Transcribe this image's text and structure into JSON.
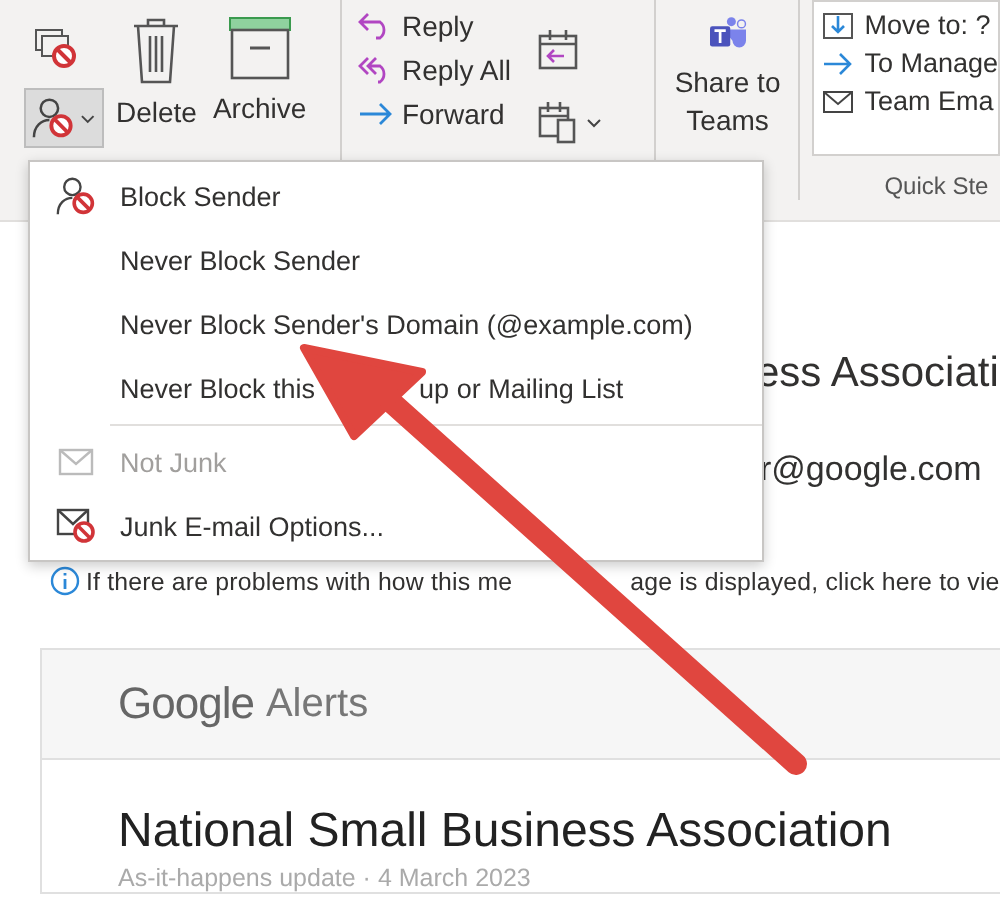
{
  "ribbon": {
    "delete": "Delete",
    "archive": "Archive",
    "respond": [
      "Reply",
      "Reply All",
      "Forward"
    ],
    "share": [
      "Share to",
      "Teams"
    ],
    "quick_steps": [
      "Move to: ?",
      "To Manage",
      "Team Ema"
    ],
    "quick_steps_label": "Quick Ste"
  },
  "menu": {
    "items": [
      {
        "kind": "block",
        "label": "Block Sender",
        "disabled": false
      },
      {
        "kind": "text",
        "label": "Never Block Sender",
        "disabled": false
      },
      {
        "kind": "text",
        "label": "Never Block Sender's Domain (@example.com)",
        "disabled": false
      },
      {
        "kind": "text",
        "label": "Never Block this",
        "label_end": "up or Mailing List",
        "disabled": false
      },
      {
        "kind": "separator"
      },
      {
        "kind": "envelope",
        "label": "Not Junk",
        "disabled": true
      },
      {
        "kind": "options",
        "label": "Junk E-mail Options...",
        "disabled": false
      }
    ]
  },
  "message": {
    "subject": "ess Associati",
    "sender": "r@google.com",
    "info": "If there are problems with how this me",
    "info_end": "age is displayed, click here to vie",
    "card": {
      "brand": "Google",
      "product": "Alerts",
      "title": "National Small Business Association",
      "meta": "As-it-happens update · 4 March 2023"
    }
  }
}
